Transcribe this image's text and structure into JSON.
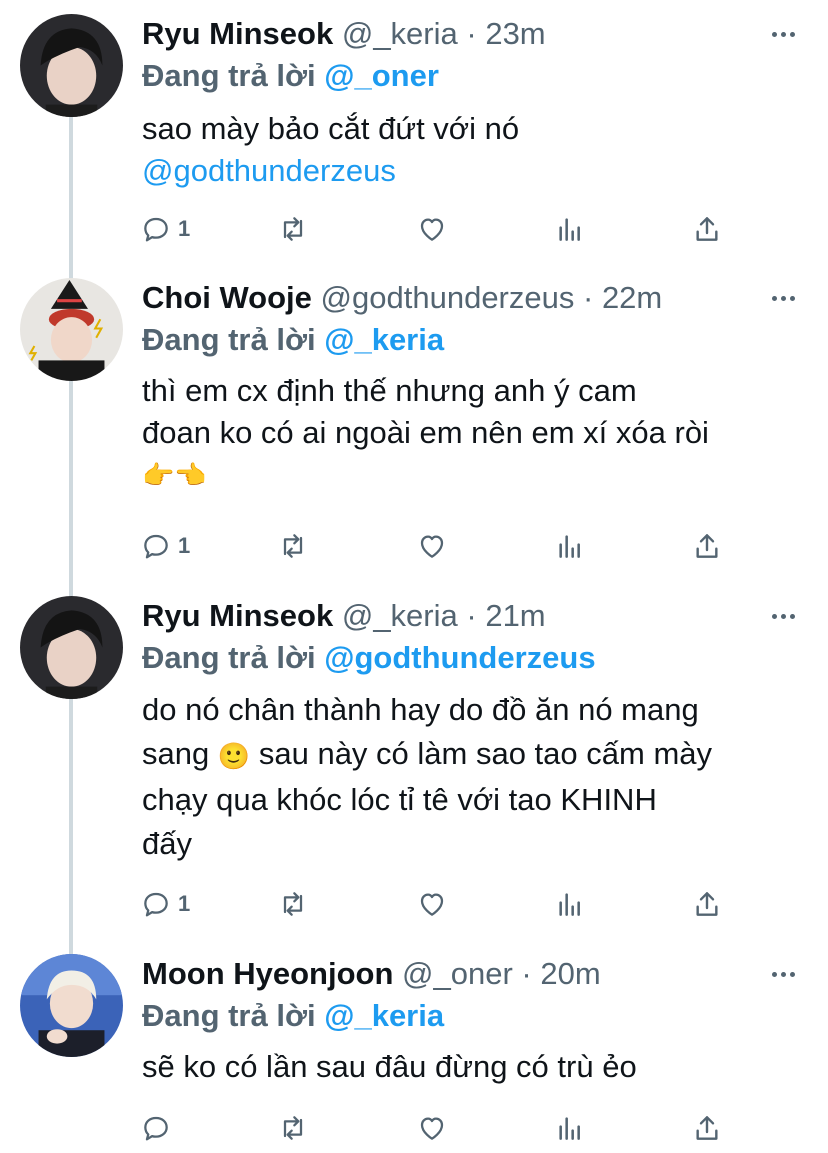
{
  "colors": {
    "link": "#1d9bf0",
    "muted": "#536471",
    "text": "#0f1419",
    "line": "#cfd9de"
  },
  "tweets": [
    {
      "name": "Ryu Minseok",
      "handle": "@_keria",
      "sep": "·",
      "time": "23m",
      "reply_prefix": "Đang trả lời ",
      "reply_to": "@_oner",
      "lines": [
        "sao mày bảo cắt đứt với nó"
      ],
      "mention_line": "@godthunderzeus",
      "reply_count": "1"
    },
    {
      "name": "Choi Wooje",
      "handle": "@godthunderzeus",
      "sep": "·",
      "time": "22m",
      "reply_prefix": "Đang trả lời ",
      "reply_to": "@_keria",
      "lines": [
        "thì em cx định thế nhưng anh ý cam",
        "đoan ko có ai ngoài em nên em xí xóa ròi"
      ],
      "emoji_line": "👉👈",
      "reply_count": "1"
    },
    {
      "name": "Ryu Minseok",
      "handle": "@_keria",
      "sep": "·",
      "time": "21m",
      "reply_prefix": "Đang trả lời ",
      "reply_to": "@godthunderzeus",
      "line1": "do nó chân thành hay do đồ ăn nó mang",
      "line2_a": "sang",
      "line2_emoji": "🙂",
      "line2_b": "sau này có làm sao tao cấm mày",
      "line3": "chạy qua khóc lóc tỉ tê với tao KHINH",
      "line4": "đấy",
      "reply_count": "1"
    },
    {
      "name": "Moon Hyeonjoon",
      "handle": "@_oner",
      "sep": "·",
      "time": "20m",
      "reply_prefix": "Đang trả lời ",
      "reply_to": "@_keria",
      "lines": [
        "sẽ ko có lần sau đâu đừng có trù ẻo"
      ],
      "reply_count": ""
    }
  ],
  "icons": [
    "reply-icon",
    "retweet-icon",
    "like-icon",
    "views-icon",
    "share-icon",
    "more-icon"
  ]
}
